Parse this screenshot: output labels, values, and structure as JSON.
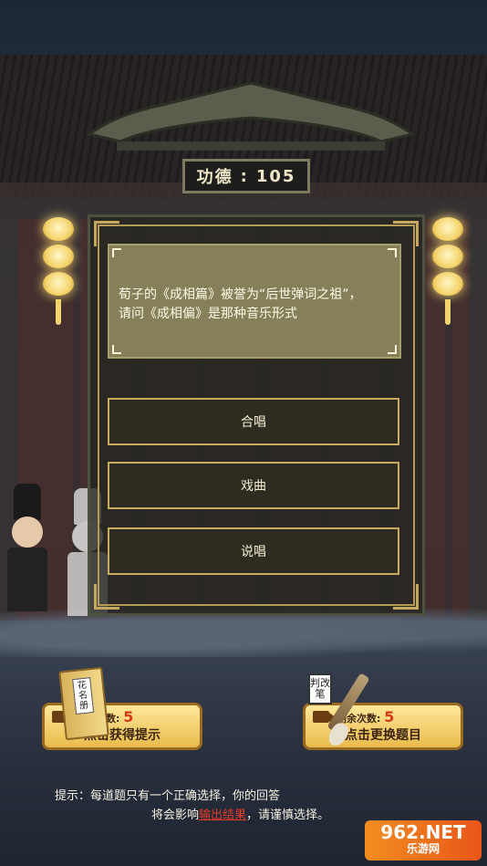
{
  "merit": {
    "label": "功德",
    "colon": ":",
    "value": "105"
  },
  "question": {
    "line1": "荀子的《成相篇》被誉为“后世弹词之祖”，",
    "line2": "请问《成相偏》是那种音乐形式"
  },
  "options": [
    {
      "label": "合唱"
    },
    {
      "label": "戏曲"
    },
    {
      "label": "说唱"
    }
  ],
  "hint_button": {
    "remaining_label": "剩余次数:",
    "remaining_count": "5",
    "action": "点击获得提示",
    "badge": "花名册"
  },
  "change_button": {
    "remaining_label": "剩余次数:",
    "remaining_count": "5",
    "action": "点击更换题目",
    "badge": "判改笔"
  },
  "tip": {
    "prefix": "提示：",
    "line1": "每道题只有一个正确选择，你的回答",
    "line2_a": "将会影响",
    "line2_highlight": "输出结果",
    "line2_b": "，请谨慎选择。"
  },
  "watermark": {
    "main": "962.NET",
    "sub": "乐游网"
  },
  "colors": {
    "accent_gold": "#c9ab62",
    "question_bg": "#85805a",
    "highlight_red": "#e83a2a"
  }
}
